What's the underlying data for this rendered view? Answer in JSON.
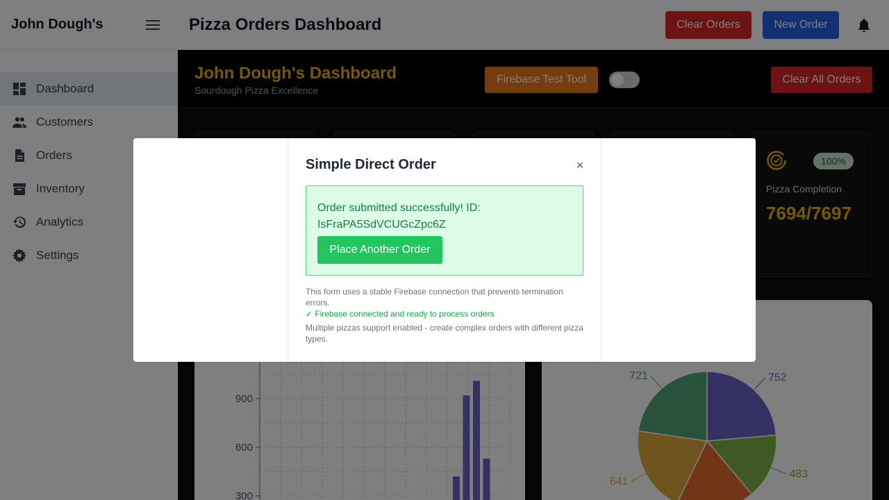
{
  "app": {
    "brand": "John Dough's",
    "page_title": "Pizza Orders Dashboard"
  },
  "header": {
    "clear_orders_label": "Clear Orders",
    "new_order_label": "New Order"
  },
  "sidebar": {
    "items": [
      {
        "label": "Dashboard",
        "icon": "dashboard-icon",
        "active": true
      },
      {
        "label": "Customers",
        "icon": "customers-icon"
      },
      {
        "label": "Orders",
        "icon": "orders-icon"
      },
      {
        "label": "Inventory",
        "icon": "inventory-icon"
      },
      {
        "label": "Analytics",
        "icon": "analytics-icon"
      },
      {
        "label": "Settings",
        "icon": "settings-icon"
      }
    ]
  },
  "dashboard": {
    "title": "John Dough's Dashboard",
    "subtitle": "Sourdough Pizza Excellence",
    "firebase_tool_label": "Firebase Test Tool",
    "clear_all_label": "Clear All Orders",
    "stat": {
      "badge": "100%",
      "label": "Pizza Completion",
      "value": "7694/7697"
    }
  },
  "bar_chart": {
    "y_ticks": [
      "900",
      "600",
      "300"
    ],
    "values": [
      0,
      0,
      0,
      0,
      0,
      0,
      0,
      0,
      0,
      0,
      0,
      0,
      0,
      0,
      30,
      0,
      0,
      0,
      420,
      920,
      1010,
      530,
      0
    ]
  },
  "pie_chart": {
    "slices": [
      {
        "label": "752",
        "value": 752,
        "color": "#6c63c7"
      },
      {
        "label": "483",
        "value": 483,
        "color": "#7cb342"
      },
      {
        "label": "",
        "value": 580,
        "color": "#e36a2f"
      },
      {
        "label": "641",
        "value": 641,
        "color": "#e0a93b"
      },
      {
        "label": "721",
        "value": 721,
        "color": "#52a57a"
      }
    ]
  },
  "modal": {
    "title": "Simple Direct Order",
    "close": "×",
    "success_message": "Order submitted successfully! ID: IsFraPA5SdVCUGcZpc6Z",
    "place_another_label": "Place Another Order",
    "note_form": "This form uses a stable Firebase connection that prevents termination errors.",
    "note_connected": "✓ Firebase connected and ready to process orders",
    "note_multi": "Multiple pizzas support enabled - create complex orders with different pizza types."
  },
  "colors": {
    "accent": "#eab308",
    "danger": "#dc2626",
    "primary": "#2563eb",
    "success": "#22c55e",
    "warning": "#ea7a1a"
  }
}
